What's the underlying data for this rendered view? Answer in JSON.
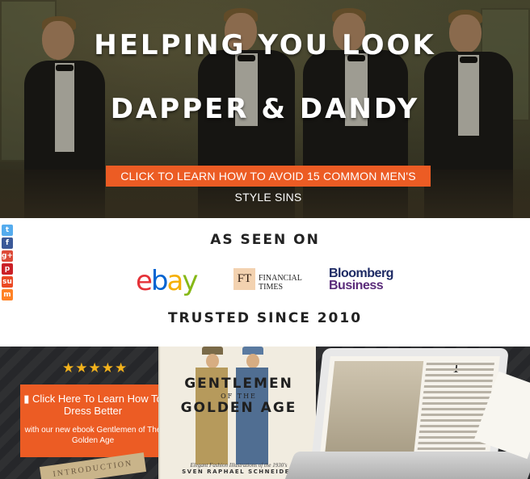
{
  "hero": {
    "title_line1": "HELPING YOU LOOK",
    "title_line2": "DAPPER & DANDY",
    "cta_label": "CLICK TO LEARN HOW TO AVOID 15 COMMON MEN'S STYLE SINS"
  },
  "social": {
    "items": [
      {
        "icon": "twitter-icon",
        "glyph": "t",
        "color": "#55acee"
      },
      {
        "icon": "facebook-icon",
        "glyph": "f",
        "color": "#3b5998"
      },
      {
        "icon": "google-plus-icon",
        "glyph": "g+",
        "color": "#dd4b39"
      },
      {
        "icon": "pinterest-icon",
        "glyph": "p",
        "color": "#cb2027"
      },
      {
        "icon": "stumbleupon-icon",
        "glyph": "su",
        "color": "#eb4924"
      },
      {
        "icon": "mix-icon",
        "glyph": "m",
        "color": "#ff8226"
      }
    ]
  },
  "as_seen_on": {
    "heading": "AS SEEN ON",
    "logos": {
      "ebay": {
        "letters": [
          "e",
          "b",
          "a",
          "y"
        ],
        "colors": [
          "#e53238",
          "#0064d2",
          "#f5af02",
          "#86b817"
        ]
      },
      "ft": {
        "box": "FT",
        "line1": "FINANCIAL",
        "line2": "TIMES"
      },
      "bloomberg": {
        "line1": "Bloomberg",
        "line2": "Business"
      }
    },
    "trusted": "TRUSTED SINCE 2010"
  },
  "ebook": {
    "stars": "★★★★★",
    "cta_line1": "Click Here To Learn How To Dress Better",
    "cta_line2": "with our new ebook Gentlemen of The Golden Age",
    "intro_strip": "INTRODUCTION",
    "book": {
      "title1": "GENTLEMEN",
      "title2": "OF THE",
      "title3": "GOLDEN AGE",
      "subtitle": "Elegant Fashion Illustrations of the 1930's",
      "author": "SVEN RAPHAEL SCHNEIDER"
    },
    "laptop_dropcap": "T"
  },
  "colors": {
    "accent": "#ec5c24",
    "star": "#f3b21c"
  }
}
